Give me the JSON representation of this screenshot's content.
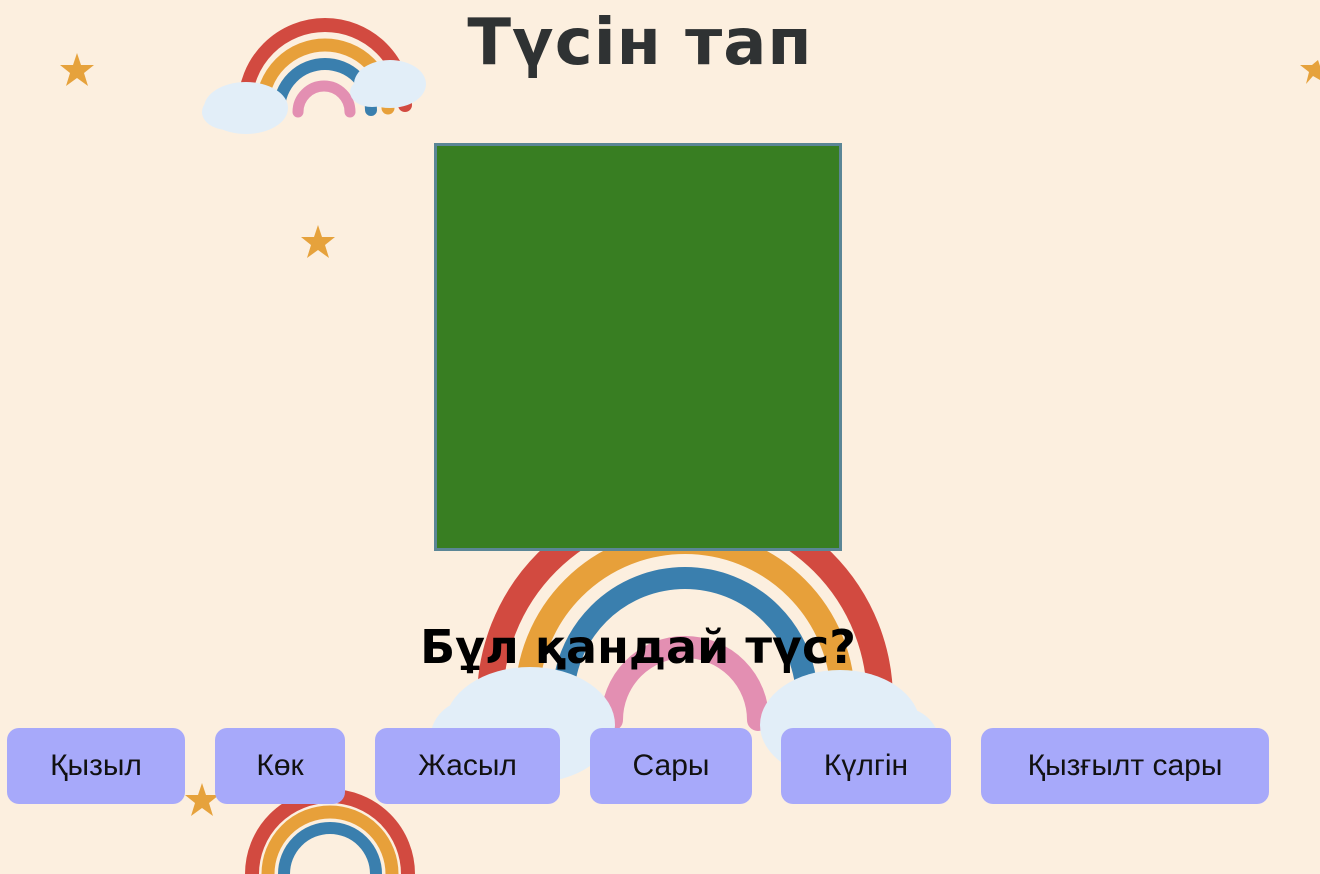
{
  "title": "Түсін тап",
  "question": "Бұл қандай түс?",
  "current_color": "#387e22",
  "answers": [
    {
      "label": "Қызыл"
    },
    {
      "label": "Көк"
    },
    {
      "label": "Жасыл"
    },
    {
      "label": "Сары"
    },
    {
      "label": "Күлгін"
    },
    {
      "label": "Қызғылт сары"
    }
  ],
  "colors": {
    "background": "#fcefdf",
    "button": "#a7a9fa",
    "square_border": "#5b8696"
  }
}
